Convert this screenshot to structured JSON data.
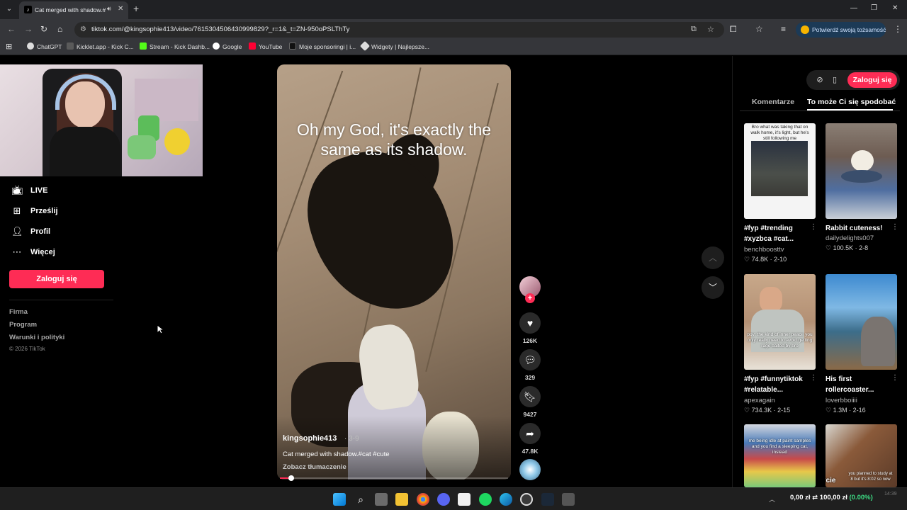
{
  "browser": {
    "tab_title": "Cat merged with shadow.#",
    "tab_audio_icon": "speaker-icon",
    "new_tab": "+",
    "url": "tiktok.com/@kingsophie413/video/7615304506430999829?_r=1&_t=ZN-950oPSLThTy",
    "verify_identity": "Potwierdź swoją tożsamość",
    "bookmarks": [
      "ChatGPT",
      "Kicklet.app - Kick C...",
      "Stream - Kick Dashb...",
      "Google",
      "YouTube",
      "Moje sponsoringi | i...",
      "Widgety | Najlepsze..."
    ],
    "window_controls": [
      "—",
      "❐",
      "✕"
    ]
  },
  "sidebar": {
    "items": [
      {
        "label": "LIVE",
        "icon": "live-icon"
      },
      {
        "label": "Prześlij",
        "icon": "upload-icon"
      },
      {
        "label": "Profil",
        "icon": "profile-icon"
      },
      {
        "label": "Więcej",
        "icon": "more-icon"
      }
    ],
    "login_button": "Zaloguj się",
    "footer_links": [
      "Firma",
      "Program",
      "Warunki i polityki"
    ],
    "copyright": "© 2026 TikTok"
  },
  "video": {
    "overlay_text": "Oh my God, it's exactly the same as its shadow.",
    "author": "kingsophie413",
    "date": "· 3-9",
    "description": "Cat merged with shadow.#cat #cute",
    "translate_link": "Zobacz tłumaczenie",
    "progress_fraction": 0.05
  },
  "actions": {
    "likes": "126K",
    "comments": "329",
    "bookmarks": "9427",
    "shares": "47.8K",
    "follow": "+"
  },
  "right_panel": {
    "login_button": "Zaloguj się",
    "tabs": [
      "Komentarze",
      "To może Ci się spodobać"
    ],
    "active_tab": "To może Ci się spodobać",
    "cards": [
      {
        "title": "#fyp #trending #xyzbca #cat...",
        "author": "benchboosttv",
        "stats": "♡ 74.8K · 2-10",
        "overlay": "Bro what was taking that on walk home, it's light, but he's still following me"
      },
      {
        "title": "Rabbit cuteness!",
        "author": "dailydelights007",
        "stats": "♡ 100.5K · 2-8",
        "overlay": ""
      },
      {
        "title": "#fyp #funnytiktok #relatable...",
        "author": "apexagain",
        "stats": "♡ 734.3K · 2-15",
        "overlay": "pov: the kind of inner peace you only really need to avoid getting rage baited by bro"
      },
      {
        "title": "His first rollercoaster...",
        "author": "loverbboiiii",
        "stats": "♡ 1.3M · 2-16",
        "overlay": ""
      },
      {
        "title": "",
        "author": "",
        "stats": "",
        "overlay": "me being idle at paint samples and you find a sleeping cat, instead"
      },
      {
        "title": "",
        "author": "",
        "stats": "",
        "overlay": "you planned to study at 8 but it's 8:02 so now"
      }
    ],
    "card_label_zycie": "życie"
  },
  "taskbar": {
    "balance_prefix": "0,00 zł",
    "balance_mid": "100,00 zł",
    "balance_pct": "(0.00%)",
    "time": "14:39",
    "icons": [
      "start-icon",
      "search-icon",
      "task-view-icon",
      "file-explorer-icon",
      "chrome-icon",
      "discord-icon",
      "store-icon",
      "spotify-icon",
      "edge-icon",
      "obs-icon",
      "steam-icon",
      "app-icon"
    ]
  }
}
